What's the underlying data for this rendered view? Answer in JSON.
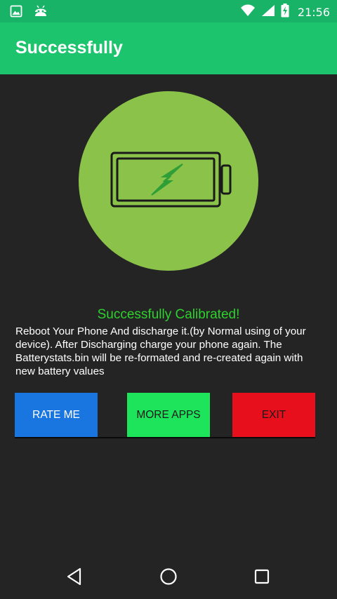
{
  "status_bar": {
    "time": "21:56",
    "left_icons": [
      "image-icon",
      "android-icon"
    ],
    "right_icons": [
      "wifi-icon",
      "signal-icon",
      "battery-charging-icon"
    ]
  },
  "app_bar": {
    "title": "Successfully"
  },
  "main": {
    "graphic_icon": "battery-charging-icon",
    "title": "Successfully Calibrated!",
    "description": "Reboot Your Phone And discharge it.(by Normal using of your device). After Discharging charge your phone again. The Batterystats.bin will be re-formated and re-created again with new battery values"
  },
  "buttons": {
    "rate_label": "RATE ME",
    "more_label": "MORE APPS",
    "exit_label": "EXIT"
  },
  "nav_bar": {
    "icons": [
      "back-icon",
      "home-icon",
      "recents-icon"
    ]
  },
  "colors": {
    "status_bar": "#19b368",
    "app_bar": "#1cc46e",
    "background": "#242424",
    "circle": "#8bc34a",
    "title_text": "#2ed12e",
    "rate_button": "#1976e0",
    "more_button": "#1ee45c",
    "exit_button": "#e80f1c"
  }
}
